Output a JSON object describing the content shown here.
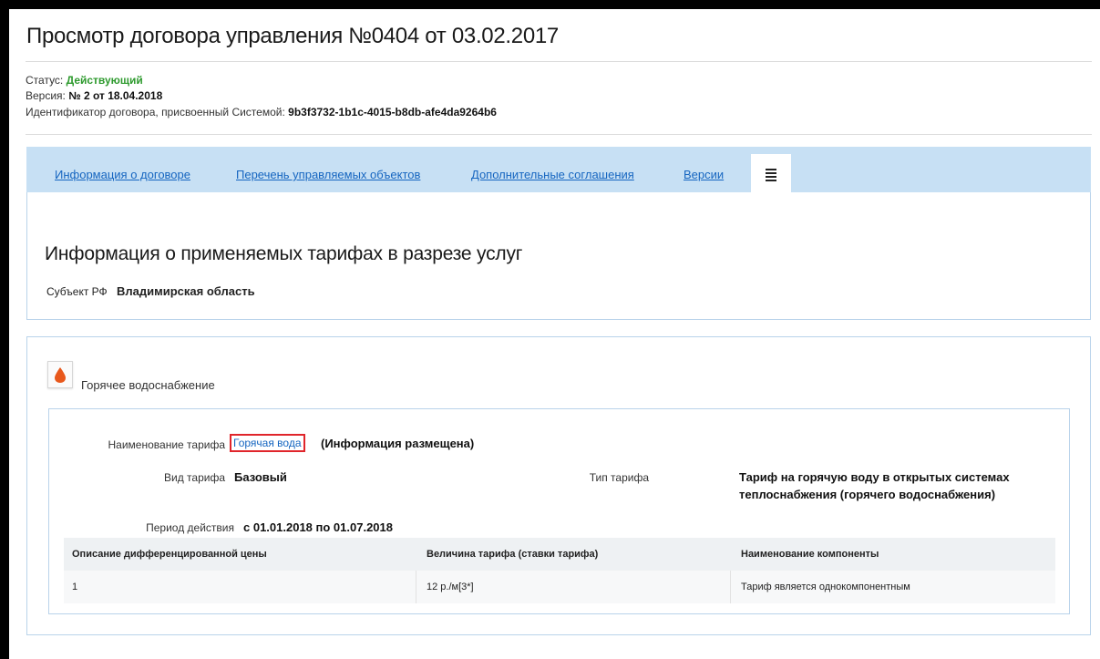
{
  "page": {
    "title": "Просмотр договора управления №0404 от 03.02.2017"
  },
  "meta": {
    "status_label": "Статус:",
    "status_value": "Действующий",
    "version_label": "Версия:",
    "version_value": "№ 2 от 18.04.2018",
    "id_label": "Идентификатор договора, присвоенный Системой:",
    "id_value": "9b3f3732-1b1c-4015-b8db-afe4da9264b6"
  },
  "tabs": [
    {
      "label": "Информация о договоре"
    },
    {
      "label": "Перечень управляемых объектов"
    },
    {
      "label": "Дополнительные соглашения"
    },
    {
      "label": "Версии"
    }
  ],
  "section": {
    "title": "Информация о применяемых тарифах в разрезе услуг",
    "subject_label": "Субъект РФ",
    "subject_value": "Владимирская область"
  },
  "service": {
    "icon": "water-drop-icon",
    "name": "Горячее водоснабжение",
    "tariff_name_label": "Наименование тарифа",
    "tariff_name_link": "Горячая вода",
    "tariff_status": "(Информация размещена)",
    "tariff_kind_label": "Вид тарифа",
    "tariff_kind_value": "Базовый",
    "tariff_type_label": "Тип тарифа",
    "tariff_type_value_line1": "Тариф на горячую воду в открытых системах",
    "tariff_type_value_line2": "теплоснабжения (горячего водоснабжения)",
    "period_label": "Период действия",
    "period_value": "с 01.01.2018 по 01.07.2018",
    "accent_color": "#e8581c"
  },
  "table": {
    "headers": [
      "Описание дифференцированной цены",
      "Величина тарифа (ставки тарифа)",
      "Наименование компоненты"
    ],
    "rows": [
      [
        "1",
        "12 р./м[3*]",
        "Тариф является однокомпонентным"
      ]
    ]
  }
}
